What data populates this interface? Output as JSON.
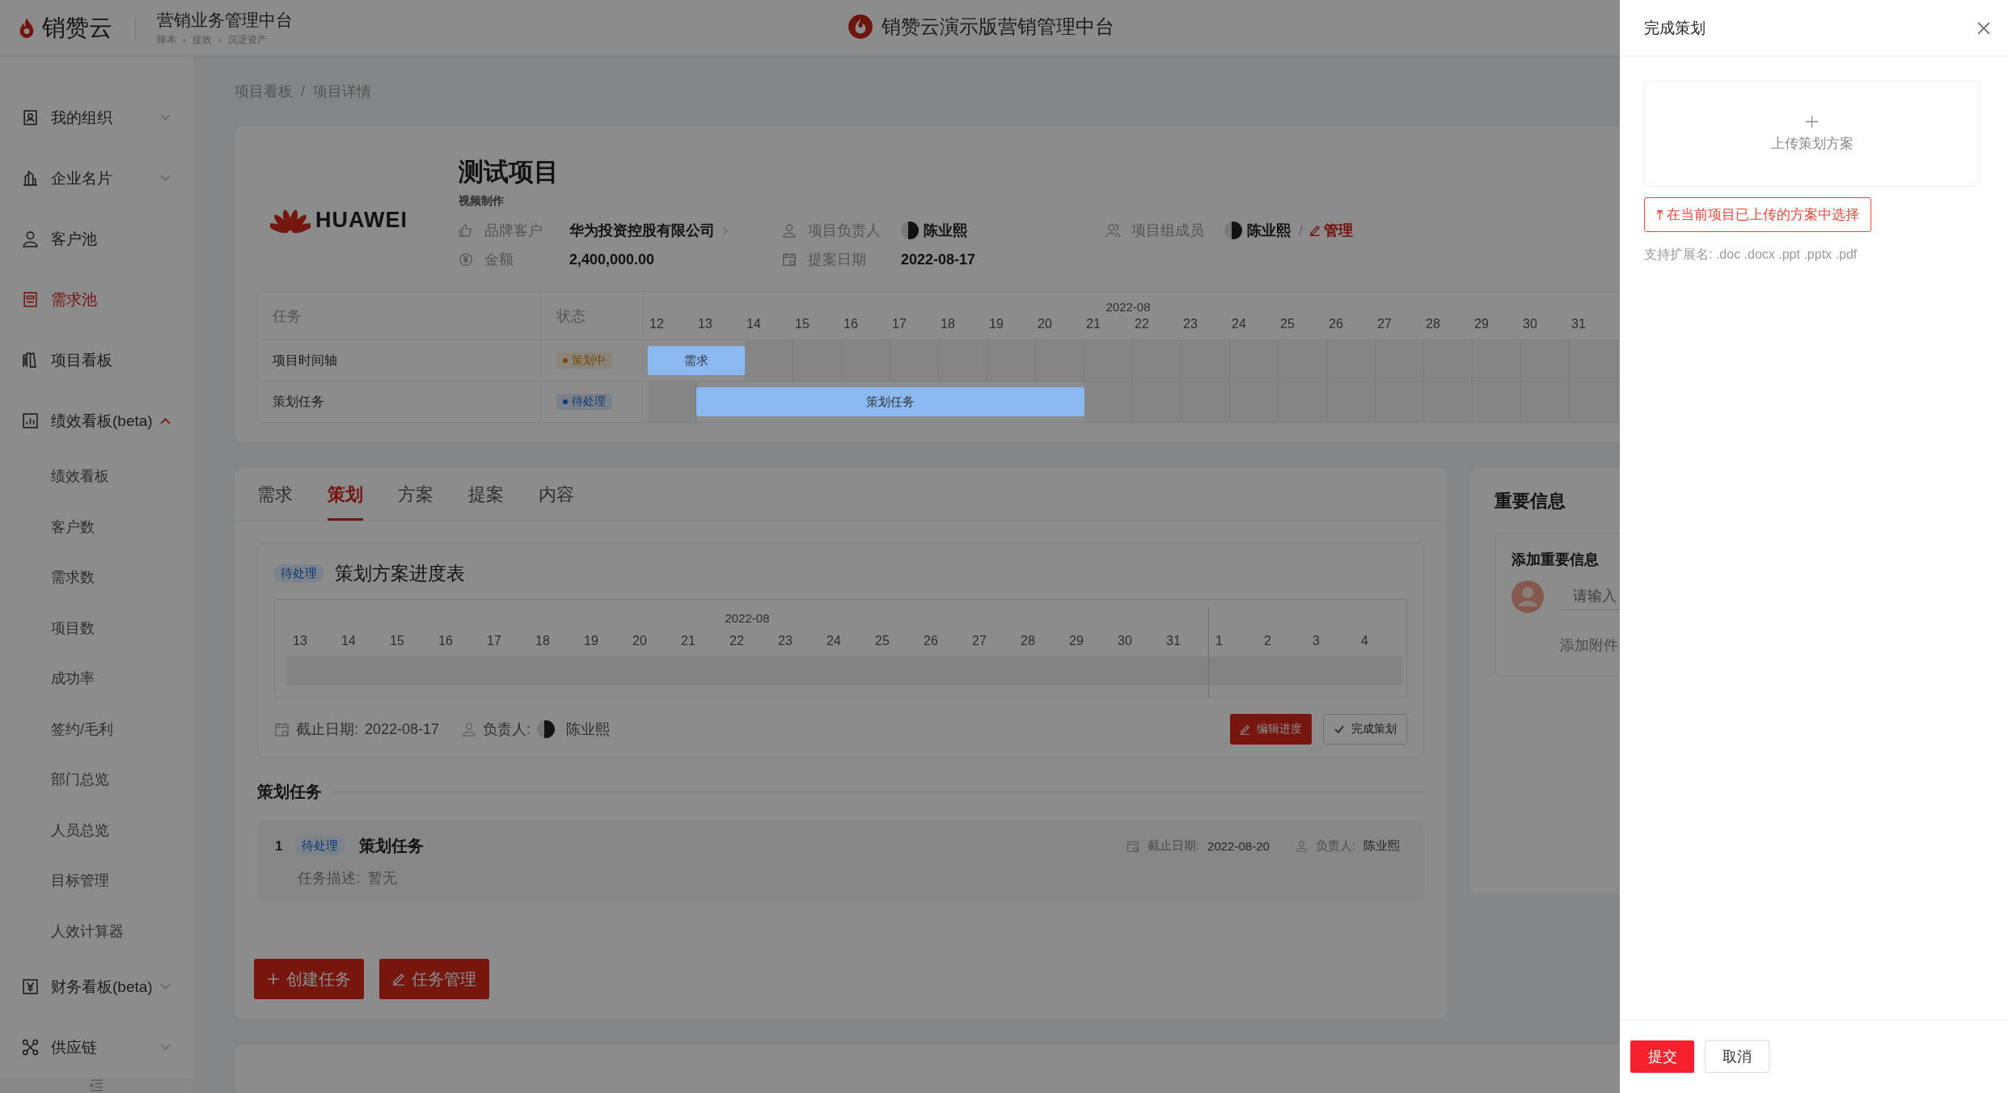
{
  "header": {
    "logo_text": "销赞云",
    "system_title": "营销业务管理中台",
    "slogans": [
      "降本",
      "提效",
      "沉淀资产"
    ],
    "center_title": "销赞云演示版营销管理中台"
  },
  "sidebar": {
    "items": [
      {
        "label": "我的组织",
        "kind": "group",
        "selected": false,
        "expanded": false
      },
      {
        "label": "企业名片",
        "kind": "group",
        "selected": false,
        "expanded": false
      },
      {
        "label": "客户池",
        "kind": "link",
        "selected": false
      },
      {
        "label": "需求池",
        "kind": "link",
        "selected": true
      },
      {
        "label": "项目看板",
        "kind": "link",
        "selected": false
      },
      {
        "label": "绩效看板(beta)",
        "kind": "group",
        "selected": false,
        "expanded": true,
        "children": [
          {
            "label": "绩效看板",
            "selected": false
          },
          {
            "label": "客户数",
            "selected": false
          },
          {
            "label": "需求数",
            "selected": false
          },
          {
            "label": "项目数",
            "selected": false
          },
          {
            "label": "成功率",
            "selected": false
          },
          {
            "label": "签约/毛利",
            "selected": false
          },
          {
            "label": "部门总览",
            "selected": false
          },
          {
            "label": "人员总览",
            "selected": false
          },
          {
            "label": "目标管理",
            "selected": false
          },
          {
            "label": "人效计算器",
            "selected": false
          }
        ]
      },
      {
        "label": "财务看板(beta)",
        "kind": "group",
        "selected": false,
        "expanded": false
      },
      {
        "label": "供应链",
        "kind": "group",
        "selected": false,
        "expanded": false
      }
    ]
  },
  "breadcrumb": {
    "items": [
      "项目看板",
      "项目详情"
    ],
    "separator": "/"
  },
  "project": {
    "logo_text": "HUAWEI",
    "title": "测试项目",
    "subtitle": "视频制作",
    "fields": [
      {
        "label": "品牌客户",
        "value": "华为投资控股有限公司",
        "kind": "link"
      },
      {
        "label": "项目负责人",
        "value": "陈业熙",
        "kind": "person"
      },
      {
        "label": "项目组成员",
        "value": "陈业熙",
        "kind": "members",
        "separator": "/",
        "action": "管理"
      },
      {
        "label": "金额",
        "value": "2,400,000.00",
        "kind": "text"
      },
      {
        "label": "提案日期",
        "value": "2022-08-17",
        "kind": "text"
      }
    ],
    "gantt": {
      "columns": [
        "任务",
        "状态"
      ],
      "month": "2022-08",
      "days": [
        "12",
        "13",
        "14",
        "15",
        "16",
        "17",
        "18",
        "19",
        "20",
        "21",
        "22",
        "23",
        "24",
        "25",
        "26",
        "27",
        "28",
        "29",
        "30",
        "31"
      ],
      "rows": [
        {
          "task": "项目时间轴",
          "status": "策划中",
          "kind": "planning",
          "bar": {
            "label": "需求",
            "covers": [
              true,
              true,
              false,
              false,
              false,
              false,
              false,
              false,
              false,
              false,
              false,
              false,
              false,
              false,
              false,
              false,
              false,
              false,
              false,
              false
            ]
          }
        },
        {
          "task": "策划任务",
          "status": "待处理",
          "kind": "pending",
          "bar": {
            "label": "策划任务",
            "covers": [
              false,
              true,
              true,
              true,
              true,
              true,
              true,
              true,
              true,
              false,
              false,
              false,
              false,
              false,
              false,
              false,
              false,
              false,
              false,
              false
            ]
          }
        }
      ]
    }
  },
  "tabs": [
    {
      "label": "需求",
      "selected": false
    },
    {
      "label": "策划",
      "selected": true
    },
    {
      "label": "方案",
      "selected": false
    },
    {
      "label": "提案",
      "selected": false
    },
    {
      "label": "内容",
      "selected": false
    }
  ],
  "progress": {
    "status": "待处理",
    "title": "策划方案进度表",
    "months": [
      {
        "label": "2022-08",
        "days": [
          "13",
          "14",
          "15",
          "16",
          "17",
          "18",
          "19",
          "20",
          "21",
          "22",
          "23",
          "24",
          "25",
          "26",
          "27",
          "28",
          "29",
          "30",
          "31"
        ]
      },
      {
        "days": [
          "1",
          "2",
          "3",
          "4"
        ]
      }
    ],
    "deadline_label": "截止日期:",
    "deadline": "2022-08-17",
    "owner_label": "负责人:",
    "owner": "陈业熙",
    "buttons": [
      "编辑进度",
      "完成策划"
    ]
  },
  "tasks_section": {
    "title": "策划任务",
    "tasks": [
      {
        "index": "1",
        "status": "待处理",
        "title": "策划任务",
        "deadline_label": "截止日期:",
        "deadline": "2022-08-20",
        "owner_label": "负责人:",
        "owner": "陈业熙",
        "description_label": "任务描述:",
        "description": "暂无"
      }
    ],
    "buttons": [
      "创建任务",
      "任务管理"
    ]
  },
  "info_panel": {
    "title": "重要信息",
    "card_title": "添加重要信息",
    "input_placeholder": "请输入",
    "attachment_label": "添加附件"
  },
  "drawer": {
    "title": "完成策划",
    "upload_label": "上传策划方案",
    "select_button": "在当前项目已上传的方案中选择",
    "hint": "支持扩展名: .doc .docx .ppt .pptx .pdf",
    "buttons": [
      "提交",
      "取消"
    ]
  }
}
